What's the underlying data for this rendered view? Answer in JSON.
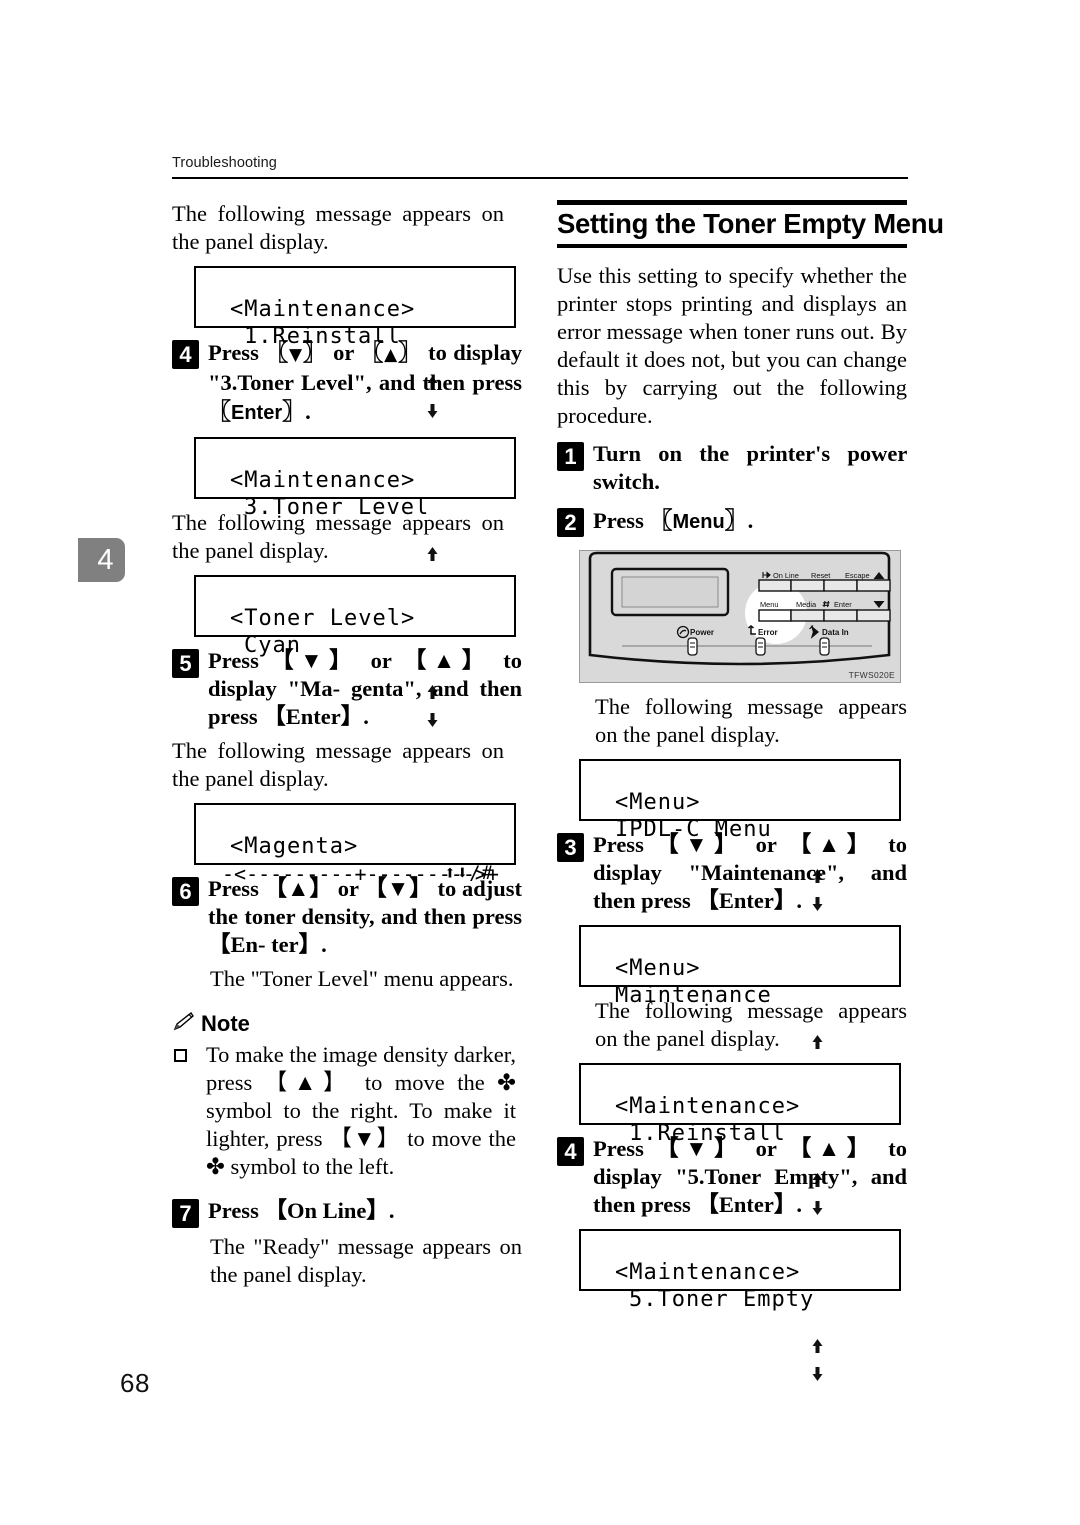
{
  "header": {
    "running_title": "Troubleshooting"
  },
  "chapter_tab": {
    "number": "4"
  },
  "page_number": "68",
  "left_column": {
    "intro_text": "The following message appears on the panel display.",
    "lcd_maintenance_reinstall": {
      "line1": "<Maintenance>",
      "line2": "1.Reinstall"
    },
    "step4": {
      "number": "4",
      "line1_a": "Press",
      "key_down": "▼",
      "line1_or": "or",
      "key_up": "▲",
      "line1_b": "to   display",
      "line2": "\"3.Toner Level\", and then press",
      "line3_key": "Enter",
      "line3_tail": "."
    },
    "lcd_maintenance_tonerlevel": {
      "line1": "<Maintenance>",
      "line2": "3.Toner Level"
    },
    "text_after_step4": "The following message appears on the panel display.",
    "lcd_tonerlevel_cyan": {
      "line1": "<Toner Level>",
      "line2": "Cyan"
    },
    "step5": {
      "number": "5",
      "line1": "Press 【▼】 or 【▲】 to display \"Ma-",
      "line2": "genta\", and then press 【Enter】."
    },
    "text_after_step5": "The following message appears on the panel display.",
    "lcd_magenta": {
      "line1_left": "<Magenta>",
      "line1_right": "⬆⬇/#",
      "line2": "-<---------+--------->+"
    },
    "step6": {
      "number": "6",
      "line1": "Press 【▲】 or 【▼】 to adjust the",
      "line2": "toner density, and then press 【En-",
      "line3": "ter】."
    },
    "text_after_step6": "The \"Toner Level\" menu appears.",
    "note": {
      "icon": "pencil-icon",
      "label": "Note",
      "items": [
        "To make the image density darker, press 【▲】 to move the ✤ symbol to the right. To make it lighter, press 【▼】 to move the ✤ symbol to the left."
      ],
      "item_lines": [
        "To   make   the   image   density",
        "darker, press 【▲】 to move the ✤",
        "symbol to the right. To make it",
        "lighter, press 【▼】 to move the ✤",
        "symbol to the left."
      ]
    },
    "step7": {
      "number": "7",
      "line1": "Press 【On Line】.",
      "key": "On Line"
    },
    "text_after_step7": "The \"Ready\" message appears on the panel display."
  },
  "right_column": {
    "section_title": "Setting the Toner Empty Menu",
    "intro_text": "Use this setting to specify whether the printer stops printing and displays an error message when toner runs out. By default it does not, but you can change this by carrying out the following procedure.",
    "step1": {
      "number": "1",
      "line1": "Turn   on   the   printer's   power",
      "line2": "switch."
    },
    "step2": {
      "number": "2",
      "text": "Press",
      "key": "Menu"
    },
    "panel_figure": {
      "figure_code": "TFWS020E",
      "buttons_row1": [
        "On Line",
        "Reset",
        "Escape",
        "▲"
      ],
      "buttons_row2": [
        "Menu",
        "Media",
        "#Enter",
        "▼"
      ],
      "indicators": [
        "Power",
        "Error",
        "Data In"
      ],
      "highlight": "menu-button"
    },
    "text_after_panel": "The following message appears on the panel display.",
    "lcd_menu_ipdlc": {
      "line1": "<Menu>",
      "line2": "IPDL-C Menu"
    },
    "step3": {
      "number": "3",
      "line1": "Press 【▼】 or 【▲】 to display",
      "line2": "\"Maintenance\", and then press",
      "line3": "【Enter】."
    },
    "lcd_menu_maintenance": {
      "line1": "<Menu>",
      "line2": "Maintenance"
    },
    "text_after_step3": "The following message appears on the panel display.",
    "lcd_maintenance_reinstall": {
      "line1": "<Maintenance>",
      "line2": "1.Reinstall"
    },
    "step4": {
      "number": "4",
      "line1": "Press 【▼】 or 【▲】 to display",
      "line2": "\"5.Toner Empty\", and then press",
      "line3": "【Enter】."
    },
    "lcd_maintenance_tonerempty": {
      "line1": "<Maintenance>",
      "line2": "5.Toner Empty"
    }
  }
}
